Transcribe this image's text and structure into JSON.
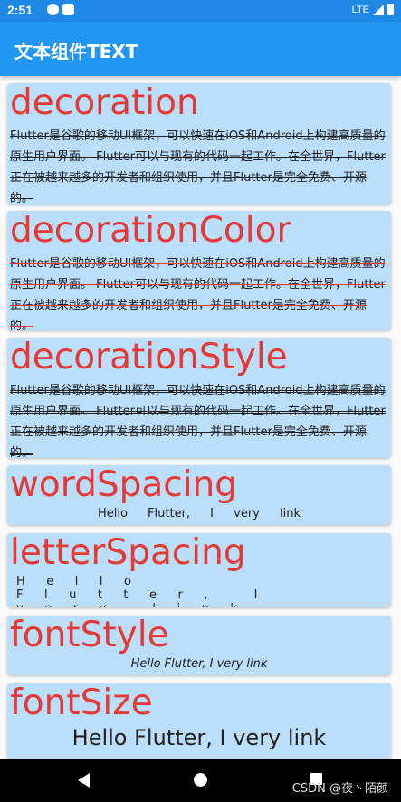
{
  "status_bar": {
    "time": "2:51",
    "network": "LTE"
  },
  "app_bar": {
    "title": "文本组件TEXT"
  },
  "sample_paragraph": "Flutter是谷歌的移动UI框架，可以快速在iOS和Android上构建高质量的原生用户界面。 Flutter可以与现有的代码一起工作。在全世界，Flutter正在被越来越多的开发者和组织使用，并且Flutter是完全免费、开源的。",
  "sample_line": "Hello Flutter, I very link",
  "cards": {
    "decoration": {
      "title": "decoration"
    },
    "decoration_color": {
      "title": "decorationColor"
    },
    "decoration_style": {
      "title": "decorationStyle"
    },
    "word_spacing": {
      "title": "wordSpacing"
    },
    "letter_spacing": {
      "title": "letterSpacing"
    },
    "font_style": {
      "title": "fontStyle"
    },
    "font_size": {
      "title": "fontSize"
    }
  },
  "watermark": "CSDN @夜丶陌颜",
  "colors": {
    "app_bar": "#2196f3",
    "status_bar": "#1e88e5",
    "card_background": "#bbdefb",
    "heading_text": "#e53935"
  },
  "icons": {
    "status_left": [
      "notification-icon",
      "sim-icon"
    ],
    "status_right": [
      "signal-icon",
      "battery-icon"
    ],
    "nav": [
      "back-icon",
      "home-icon",
      "recents-icon"
    ]
  }
}
